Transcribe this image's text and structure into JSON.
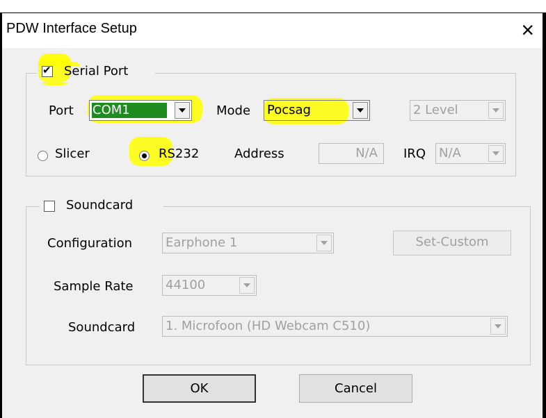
{
  "window": {
    "title": "PDW Interface Setup",
    "close_glyph": "×"
  },
  "serial": {
    "group_label": "Serial Port",
    "enabled": true,
    "port_label": "Port",
    "port_value": "COM1",
    "mode_label": "Mode",
    "mode_value": "Pocsag",
    "level_value": "2 Level",
    "slicer_label": "Slicer",
    "rs232_label": "RS232",
    "selected_interface": "RS232",
    "address_label": "Address",
    "address_value": "N/A",
    "irq_label": "IRQ",
    "irq_value": "N/A"
  },
  "soundcard": {
    "group_label": "Soundcard",
    "enabled": false,
    "configuration_label": "Configuration",
    "configuration_value": "Earphone 1",
    "set_custom_label": "Set-Custom",
    "sample_rate_label": "Sample Rate",
    "sample_rate_value": "44100",
    "device_label": "Soundcard",
    "device_value": "1. Microfoon (HD Webcam C510)"
  },
  "buttons": {
    "ok": "OK",
    "cancel": "Cancel"
  },
  "colors": {
    "highlight": "#ffff00",
    "port_selected_bg": "#1e8c1e",
    "accent_bg": "#f0f0f0"
  }
}
